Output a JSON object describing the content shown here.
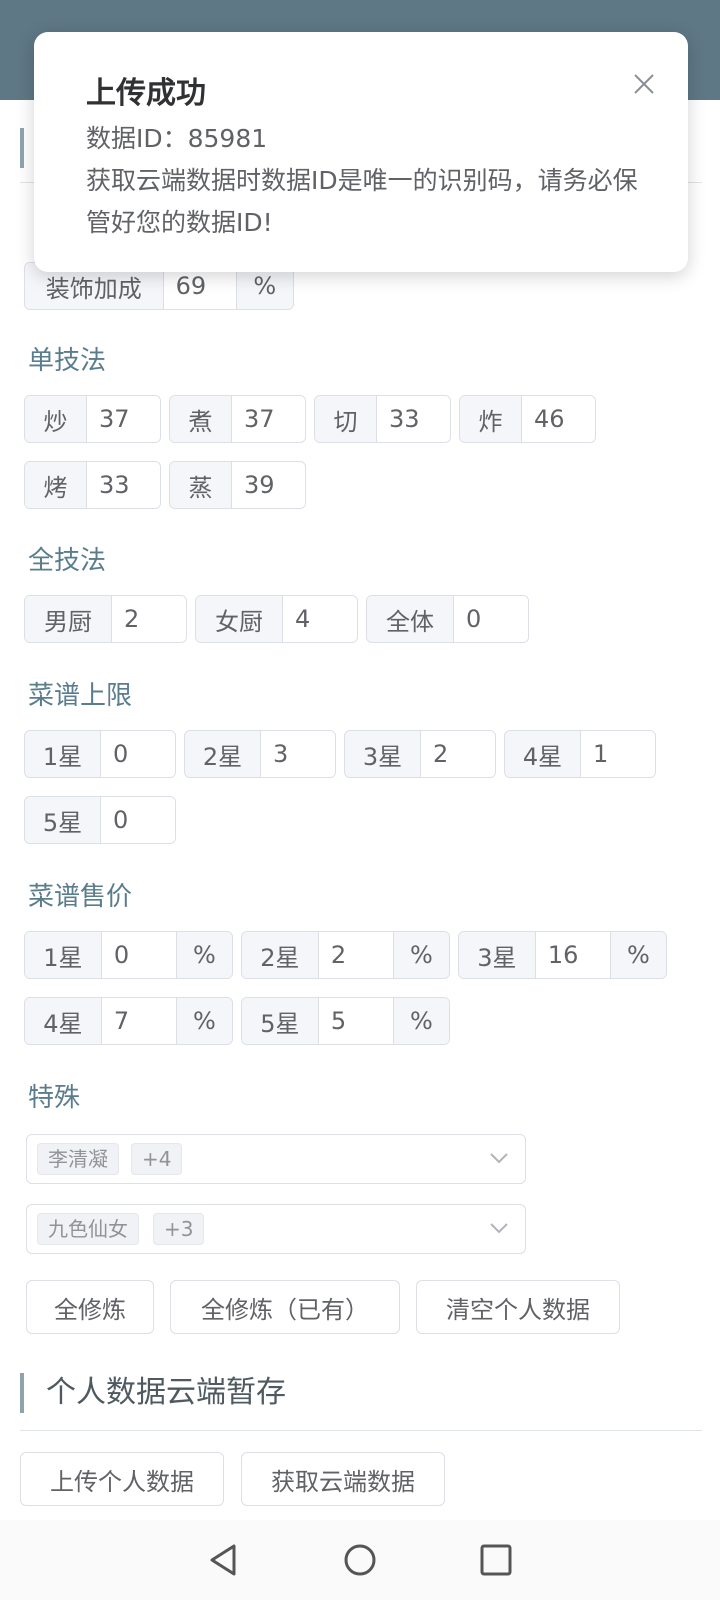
{
  "dialog": {
    "title": "上传成功",
    "id_line": "数据ID：85981",
    "message": "获取云端数据时数据ID是唯一的识别码，请务必保管好您的数据ID!"
  },
  "decor": {
    "label": "装饰加成",
    "value": "69",
    "unit": "%"
  },
  "single_skill": {
    "title": "单技法",
    "items": [
      {
        "label": "炒",
        "value": "37"
      },
      {
        "label": "煮",
        "value": "37"
      },
      {
        "label": "切",
        "value": "33"
      },
      {
        "label": "炸",
        "value": "46"
      },
      {
        "label": "烤",
        "value": "33"
      },
      {
        "label": "蒸",
        "value": "39"
      }
    ]
  },
  "all_skill": {
    "title": "全技法",
    "items": [
      {
        "label": "男厨",
        "value": "2"
      },
      {
        "label": "女厨",
        "value": "4"
      },
      {
        "label": "全体",
        "value": "0"
      }
    ]
  },
  "recipe_limit": {
    "title": "菜谱上限",
    "items": [
      {
        "label": "1星",
        "value": "0"
      },
      {
        "label": "2星",
        "value": "3"
      },
      {
        "label": "3星",
        "value": "2"
      },
      {
        "label": "4星",
        "value": "1"
      },
      {
        "label": "5星",
        "value": "0"
      }
    ]
  },
  "recipe_price": {
    "title": "菜谱售价",
    "unit": "%",
    "items": [
      {
        "label": "1星",
        "value": "0"
      },
      {
        "label": "2星",
        "value": "2"
      },
      {
        "label": "3星",
        "value": "16"
      },
      {
        "label": "4星",
        "value": "7"
      },
      {
        "label": "5星",
        "value": "5"
      }
    ]
  },
  "special": {
    "title": "特殊",
    "select1": {
      "tag": "李清凝",
      "more": "+4"
    },
    "select2": {
      "tag": "九色仙女",
      "more": "+3"
    }
  },
  "buttons": {
    "all_train": "全修炼",
    "all_train_owned": "全修炼（已有）",
    "clear_data": "清空个人数据"
  },
  "cloud": {
    "title": "个人数据云端暂存",
    "upload": "上传个人数据",
    "fetch": "获取云端数据"
  },
  "colors": {
    "header": "#5e7885",
    "label": "#5a7d8e",
    "accent_bar": "#8fa3ae"
  }
}
